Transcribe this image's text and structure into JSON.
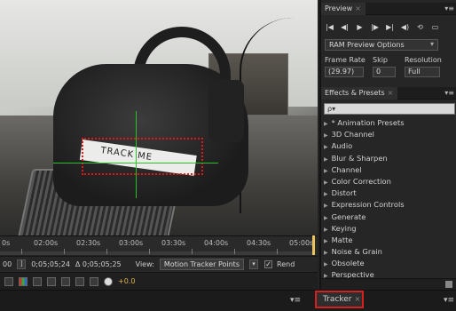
{
  "viewer": {
    "label_text": "TRACK ME"
  },
  "timeline": {
    "ticks": [
      "0s",
      "02:00s",
      "02:30s",
      "03:00s",
      "03:30s",
      "04:00s",
      "04:30s",
      "05:00s"
    ]
  },
  "status_bar": {
    "time_start": "00",
    "bracket_icon": "bracket-icon",
    "time_end": "0;05;05;24",
    "duration": "Δ 0;05;05;25",
    "view_label": "View:",
    "view_value": "Motion Tracker Points",
    "render_checked": "✓",
    "render_label": "Rend"
  },
  "viewer_toolbar": {
    "exposure": "+0.0"
  },
  "bottom": {
    "left_menu": "▾≡",
    "tracker_tab": "Tracker",
    "tracker_close": "×",
    "right_menu": "▾≡"
  },
  "preview": {
    "tab": "Preview",
    "close": "×",
    "menu": "▾≡",
    "controls": [
      "|◀",
      "◀|",
      "▶",
      "|▶",
      "▶|",
      "◀)",
      "⟲",
      "▭"
    ],
    "ram_preview": "RAM Preview Options",
    "frame_rate_label": "Frame Rate",
    "skip_label": "Skip",
    "resolution_label": "Resolution",
    "frame_rate_value": "(29.97)",
    "skip_value": "0",
    "resolution_value": "Full"
  },
  "effects": {
    "tab": "Effects & Presets",
    "close": "×",
    "menu": "▾≡",
    "search_placeholder": "ρ▾",
    "items": [
      "* Animation Presets",
      "3D Channel",
      "Audio",
      "Blur & Sharpen",
      "Channel",
      "Color Correction",
      "Distort",
      "Expression Controls",
      "Generate",
      "Keying",
      "Matte",
      "Noise & Grain",
      "Obsolete",
      "Perspective"
    ]
  },
  "colors": {
    "track_box": "#e01818",
    "crosshair": "#27c227",
    "playhead": "#e8c55c",
    "highlight": "#d42020"
  }
}
